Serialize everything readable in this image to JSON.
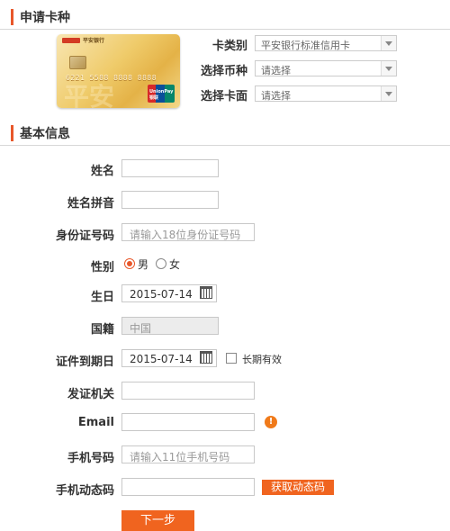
{
  "sections": {
    "apply": "申请卡种",
    "basic": "基本信息"
  },
  "card": {
    "bank": "平安银行",
    "number": "6221 5588 8888 8888",
    "watermark": "平安",
    "union_text": "UnionPay 银联"
  },
  "apply": {
    "card_type": {
      "label": "卡类别",
      "value": "平安银行标准信用卡"
    },
    "currency": {
      "label": "选择币种",
      "value": "请选择"
    },
    "face": {
      "label": "选择卡面",
      "value": "请选择"
    }
  },
  "form": {
    "name": {
      "label": "姓名",
      "value": ""
    },
    "pinyin": {
      "label": "姓名拼音",
      "value": ""
    },
    "idno": {
      "label": "身份证号码",
      "placeholder": "请输入18位身份证号码"
    },
    "gender": {
      "label": "性别",
      "male": "男",
      "female": "女",
      "selected": "男"
    },
    "birthday": {
      "label": "生日",
      "value": "2015-07-14"
    },
    "nationality": {
      "label": "国籍",
      "value": "中国"
    },
    "expiry": {
      "label": "证件到期日",
      "value": "2015-07-14",
      "longterm": "长期有效"
    },
    "issuer": {
      "label": "发证机关",
      "value": ""
    },
    "email": {
      "label": "Email",
      "value": "",
      "info_icon": "info-icon"
    },
    "mobile": {
      "label": "手机号码",
      "placeholder": "请输入11位手机号码"
    },
    "code": {
      "label": "手机动态码",
      "value": "",
      "button": "获取动态码"
    }
  },
  "next_button": "下一步",
  "colors": {
    "accent": "#f0641f",
    "bar": "#e8572a"
  }
}
